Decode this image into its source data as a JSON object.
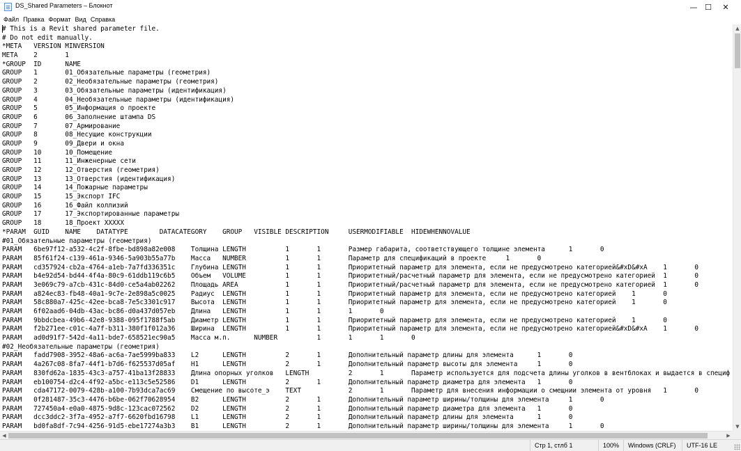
{
  "window": {
    "title": "DS_Shared Parameters – Блокнот",
    "minimize_glyph": "—",
    "maximize_glyph": "☐",
    "close_glyph": "✕"
  },
  "menu": [
    "Файл",
    "Правка",
    "Формат",
    "Вид",
    "Справка"
  ],
  "editor": {
    "lines": [
      "# This is a Revit shared parameter file.",
      "# Do not edit manually.",
      "*META   VERSION MINVERSION",
      "META    2       1",
      "*GROUP  ID      NAME",
      "GROUP   1       01_Обязательные параметры (геометрия)",
      "GROUP   2       02_Необязательные параметры (геометрия)",
      "GROUP   3       03_Обязательные параметры (идентификация)",
      "GROUP   4       04_Необязательные параметры (идентификация)",
      "GROUP   5       05_Информация о проекте",
      "GROUP   6       06_Заполнение штампа DS",
      "GROUP   7       07_Армирование",
      "GROUP   8       08_Несущие конструкции",
      "GROUP   9       09_Двери и окна",
      "GROUP   10      10_Помещение",
      "GROUP   11      11_Инженерные сети",
      "GROUP   12      12_Отверстия (геометрия)",
      "GROUP   13      13_Отверстия (идентификация)",
      "GROUP   14      14_Пожарные параметры",
      "GROUP   15      15_Экспорт IFC",
      "GROUP   16      16_Файл коллизий",
      "GROUP   17      17_Экспортированные параметры",
      "GROUP   18      18_Проект XXXXX",
      "*PARAM  GUID    NAME    DATATYPE        DATACATEGORY    GROUP   VISIBLE DESCRIPTION     USERMODIFIABLE  HIDEWHENNOVALUE",
      "#01_Обязательные параметры (геометрия)",
      "PARAM   6be97f12-a532-4c2f-8fbe-bd898a82e008    Толщина LENGTH          1       1       Размер габарита, соответствующего толщине элемента      1       0",
      "PARAM   85f61f24-c139-461a-9346-5a903b55a77b    Масса   NUMBER          1       1       Параметр для спецификаций в проекте     1       0",
      "PARAM   cd357924-cb2a-4764-a1eb-7a7fd336351c    Глубина LENGTH          1       1       Приоритетный параметр для элемента, если не предусмотрено категорией&#xD&#xA    1       0",
      "PARAM   b4e92d54-bd44-4f4a-80c9-61ddb119c6b5    Объем   VOLUME          1       1       Приоритетный/расчетный параметр для элемента, если не предусмотрено категорией  1       0",
      "PARAM   3e069c79-a7cb-431c-84d0-ce5a4ab02262    Площадь AREA            1       1       Приоритетный/расчетный параметр для элемента, если не предусмотрено категорией  1       0",
      "PARAM   a824ec83-fb48-40a1-9c7e-2e898a5c0025    Радиус  LENGTH          1       1       Приоритетный параметр для элемента, если не предусмотрено категорией    1       0",
      "PARAM   58c880a7-425c-42ee-bca8-7e5c3301c917    Высота  LENGTH          1       1       Приоритетный параметр для элемента, если не предусмотрено категорией    1       0",
      "PARAM   6f02aad6-04db-43ac-bc86-d0a437d057eb    Длина   LENGTH          1       1       1       0",
      "PARAM   9bbdcbea-49b6-42e8-9388-095f1788f5ab    Диаметр LENGTH          1       1       Приоритетный параметр для элемента, если не предусмотрено категорией    1       0",
      "PARAM   f2b271ee-c01c-4a7f-b311-380f1f012a36    Ширина  LENGTH          1       1       Приоритетный параметр для элемента, если не предусмотрено категорией&#xD&#xA    1       0",
      "PARAM   ad0d91f7-542d-4a11-bde7-658521ec90a5    Масса м.п.      NUMBER          1       1       1       0",
      "#02_Необязательные параметры (геометрия)",
      "PARAM   fadd7908-3952-48a6-ac6a-7ae5999ba833    L2      LENGTH          2       1       Дополнительный параметр длины для элемента      1       0",
      "PARAM   4a267c08-8fa7-44f1-b7d6-f625537d05af    H1      LENGTH          2       1       Дополнительный параметр высоты для элемента     1       0",
      "PARAM   830fd62a-1835-43c3-a757-41ba13f28833    Длина опорных уголков   LENGTH          2       1       Параметр используется для подсчета длины уголков в вентблоках и выдается в специф",
      "PARAM   eb100754-d2c4-4f92-a5bc-e113c5e52586    D1      LENGTH          2       1       Дополнительный параметр диаметра для элемента   1       0",
      "PARAM   cda47172-0079-428b-a100-7b93dca7ac69    Смещение по высоте_э    TEXT            2       1       Параметр для внесения информации о смещнии элемента от уровня   1       0",
      "PARAM   0f281487-35c3-4476-b6be-062f70628954    B2      LENGTH          2       1       Дополнительный параметр ширины/толщины для элемента     1       0",
      "PARAM   727450a4-e0a0-4875-9d8c-123cac072562    D2      LENGTH          2       1       Дополнительный параметр диаметра для элемента   1       0",
      "PARAM   dcc3ddc2-3f7a-4952-a7f7-6620fbd16798    L1      LENGTH          2       1       Дополнительный параметр длины для элемента      1       0",
      "PARAM   bd0fa8df-7c94-4256-91d5-ebe17274a3b3    B1      LENGTH          2       1       Дополнительный параметр ширины/толщины для элемента     1       0"
    ]
  },
  "status": {
    "position": "Стр 1, стлб 1",
    "zoom": "100%",
    "line_endings": "Windows (CRLF)",
    "encoding": "UTF-16 LE"
  },
  "scroll": {
    "up": "▲",
    "down": "▼",
    "left": "◀",
    "right": "▶"
  }
}
